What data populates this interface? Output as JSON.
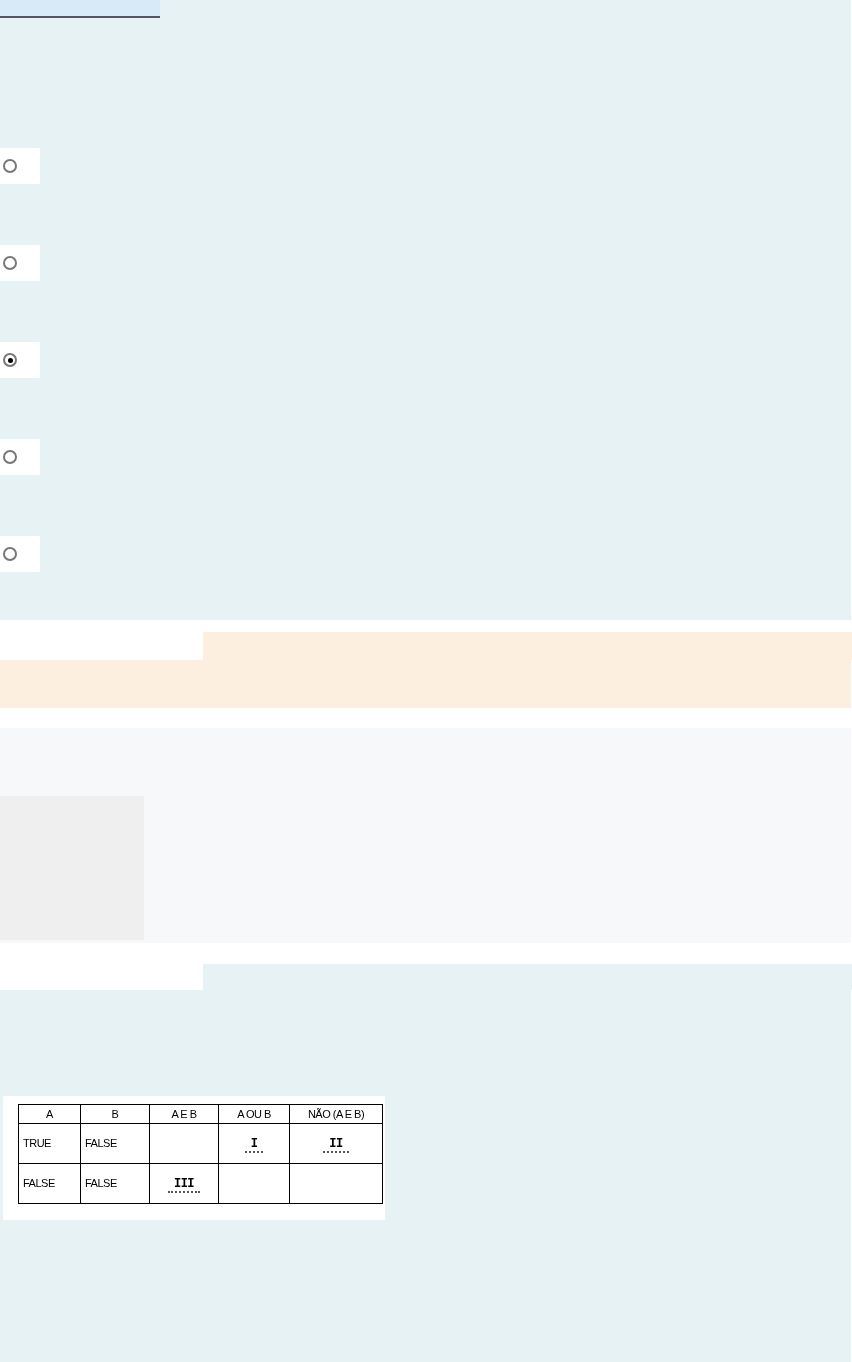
{
  "question": {
    "options": [
      {
        "selected": false
      },
      {
        "selected": false
      },
      {
        "selected": true
      },
      {
        "selected": false
      },
      {
        "selected": false
      }
    ]
  },
  "table": {
    "columns": [
      "A",
      "B",
      "A E B",
      "A OU B",
      "NÃO (A E B)"
    ],
    "rows": [
      [
        "TRUE",
        "FALSE",
        "",
        "I",
        "II"
      ],
      [
        "FALSE",
        "FALSE",
        "III",
        "",
        ""
      ]
    ]
  }
}
